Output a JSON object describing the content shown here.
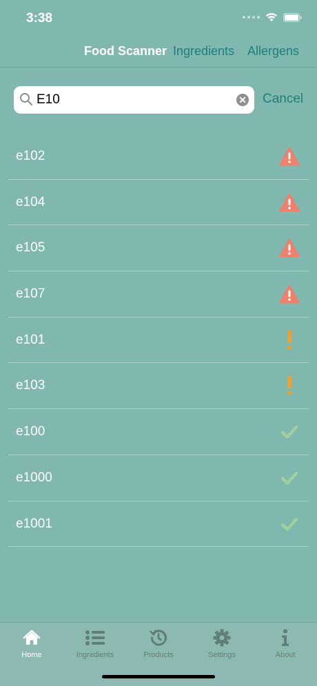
{
  "status_bar": {
    "time": "3:38",
    "icons": [
      "signal-icon",
      "wifi-icon",
      "battery-icon"
    ]
  },
  "nav": {
    "title": "Food Scanner",
    "links": [
      "Ingredients",
      "Allergens"
    ]
  },
  "search": {
    "value": "E10",
    "cancel_label": "Cancel"
  },
  "colors": {
    "danger": "#f0806b",
    "warning": "#f0a030",
    "ok": "#9dd09a",
    "accent": "#1e7f7b"
  },
  "results": [
    {
      "code": "e102",
      "status": "danger",
      "icon": "warning-triangle-icon"
    },
    {
      "code": "e104",
      "status": "danger",
      "icon": "warning-triangle-icon"
    },
    {
      "code": "e105",
      "status": "danger",
      "icon": "warning-triangle-icon"
    },
    {
      "code": "e107",
      "status": "danger",
      "icon": "warning-triangle-icon"
    },
    {
      "code": "e101",
      "status": "warning",
      "icon": "exclamation-icon"
    },
    {
      "code": "e103",
      "status": "warning",
      "icon": "exclamation-icon"
    },
    {
      "code": "e100",
      "status": "ok",
      "icon": "checkmark-icon"
    },
    {
      "code": "e1000",
      "status": "ok",
      "icon": "checkmark-icon"
    },
    {
      "code": "e1001",
      "status": "ok",
      "icon": "checkmark-icon"
    }
  ],
  "tabs": [
    {
      "label": "Home",
      "icon": "home-icon",
      "active": true
    },
    {
      "label": "Ingredients",
      "icon": "list-icon",
      "active": false
    },
    {
      "label": "Products",
      "icon": "history-icon",
      "active": false
    },
    {
      "label": "Settings",
      "icon": "gear-icon",
      "active": false
    },
    {
      "label": "About",
      "icon": "info-icon",
      "active": false
    }
  ]
}
